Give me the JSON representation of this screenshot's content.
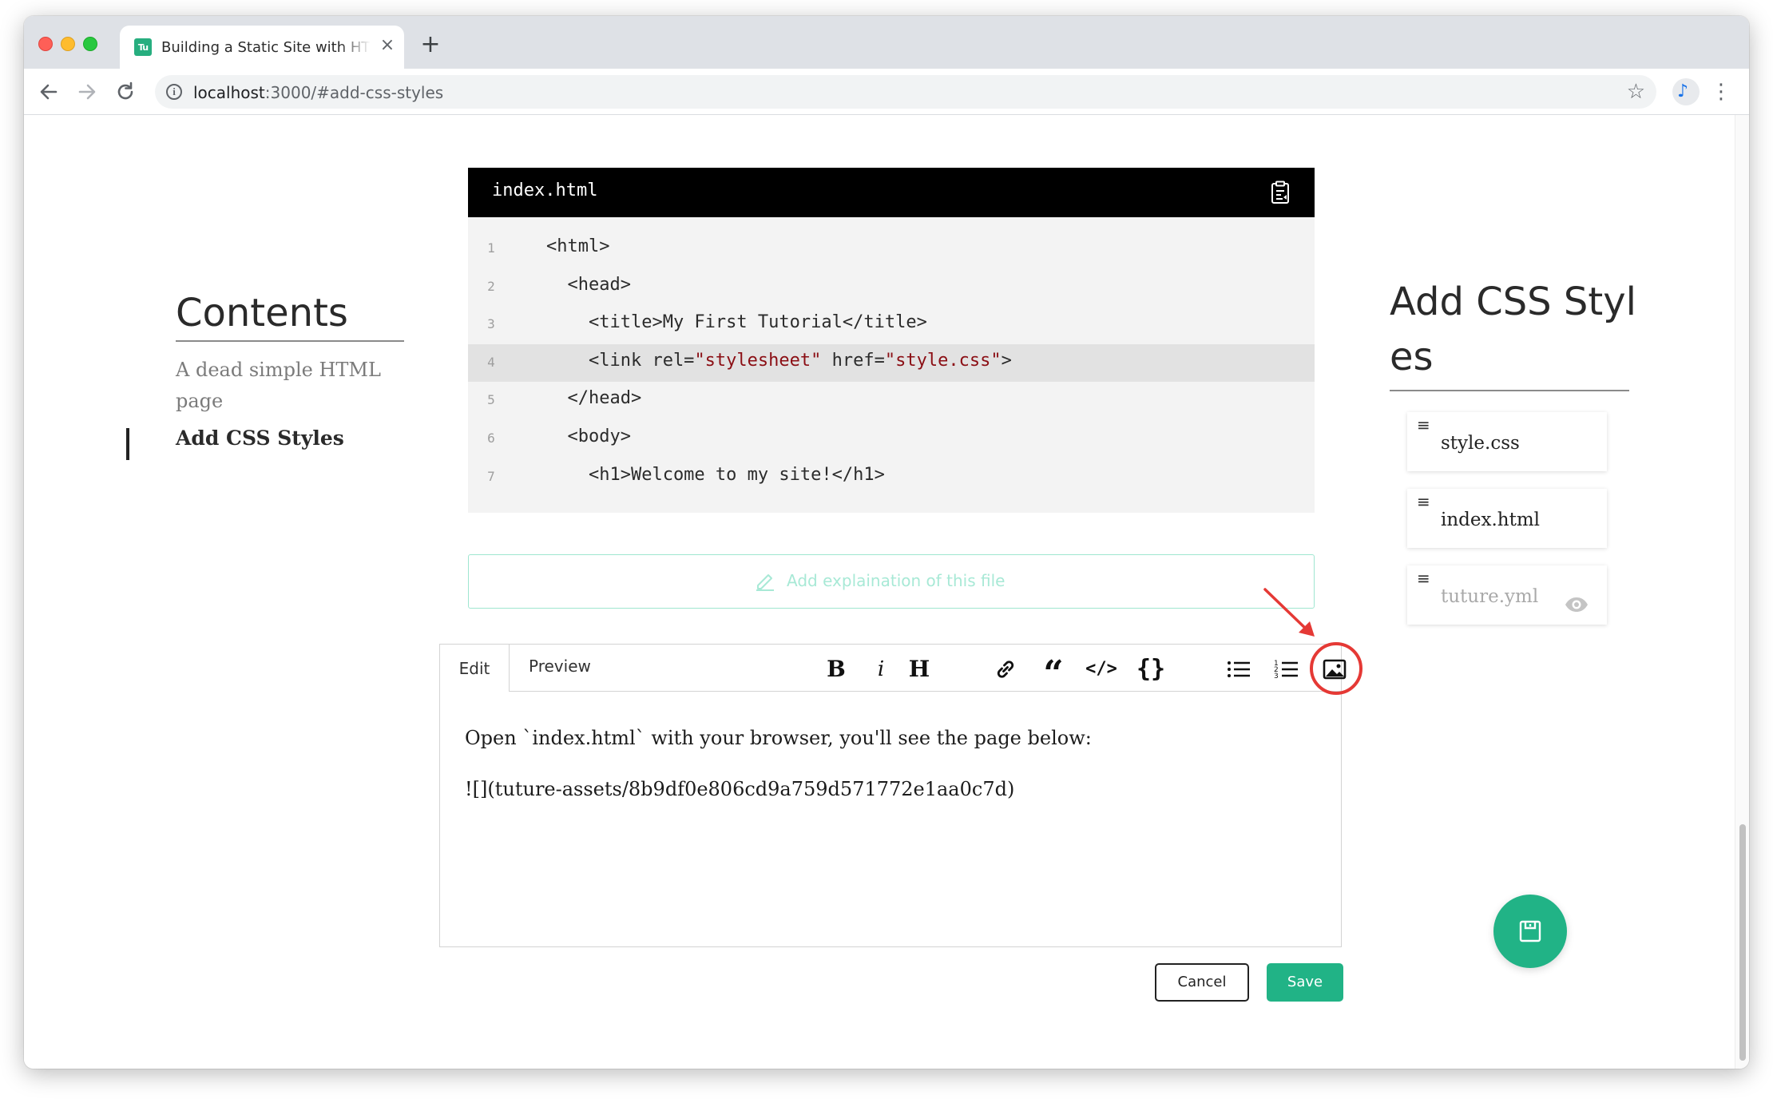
{
  "browser": {
    "tab": {
      "favicon_text": "Tu",
      "title": "Building a Static Site with HTML",
      "close": "×"
    },
    "new_tab": "+",
    "url_host": "localhost",
    "url_path": ":3000/#add-css-styles",
    "star": "☆",
    "menu": "⋮",
    "profile": "♪"
  },
  "sidebar": {
    "title": "Contents",
    "items": [
      {
        "label": "A dead simple HTML page",
        "active": false
      },
      {
        "label": "Add CSS Styles",
        "active": true
      }
    ]
  },
  "code_block": {
    "filename": "index.html",
    "lines": [
      {
        "n": "1",
        "parts": [
          {
            "t": "<html>"
          }
        ]
      },
      {
        "n": "2",
        "parts": [
          {
            "t": "  <head>"
          }
        ]
      },
      {
        "n": "3",
        "parts": [
          {
            "t": "    <title>My First Tutorial</title>"
          }
        ]
      },
      {
        "n": "4",
        "highlight": true,
        "parts": [
          {
            "t": "    <link rel="
          },
          {
            "t": "\"stylesheet\"",
            "s": true
          },
          {
            "t": " href="
          },
          {
            "t": "\"style.css\"",
            "s": true
          },
          {
            "t": ">"
          }
        ]
      },
      {
        "n": "5",
        "parts": [
          {
            "t": "  </head>"
          }
        ]
      },
      {
        "n": "6",
        "parts": [
          {
            "t": "  <body>"
          }
        ]
      },
      {
        "n": "7",
        "parts": [
          {
            "t": "    <h1>Welcome to my site!</h1>"
          }
        ]
      }
    ]
  },
  "explanation": {
    "placeholder": "Add explaination of this file"
  },
  "editor": {
    "tabs": {
      "edit": "Edit",
      "preview": "Preview"
    },
    "toolbar": {
      "bold": "B",
      "italic": "i",
      "heading": "H",
      "quote": "“",
      "code": "</>",
      "codeblock": "{}"
    },
    "content": [
      "Open `index.html` with your browser, you'll see the page below:",
      "![](tuture-assets/8b9df0e806cd9a759d571772e1aa0c7d)"
    ],
    "cancel_label": "Cancel",
    "save_label": "Save"
  },
  "files_panel": {
    "title": "Add CSS Styles",
    "drag_glyph": "≡",
    "files": [
      {
        "name": "style.css",
        "hidden": false
      },
      {
        "name": "index.html",
        "hidden": false
      },
      {
        "name": "tuture.yml",
        "hidden": true
      }
    ]
  },
  "colors": {
    "accent": "#21b386",
    "annotation": "#e53935",
    "code_string": "#8b0e14"
  }
}
